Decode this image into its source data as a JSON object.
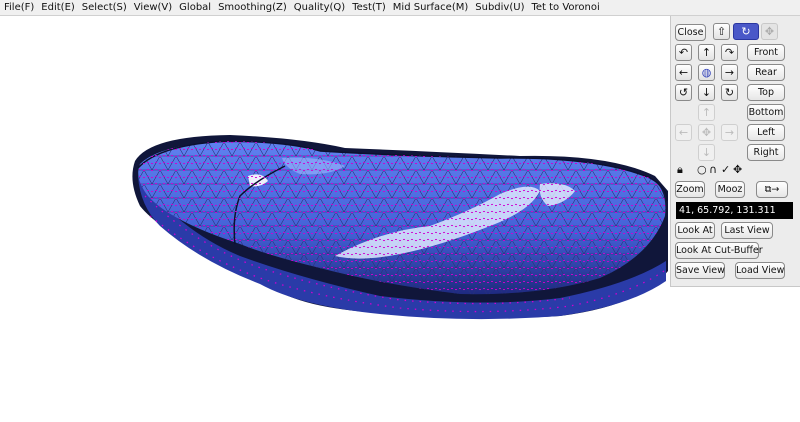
{
  "menu": [
    "File(F)",
    "Edit(E)",
    "Select(S)",
    "View(V)",
    "Global",
    "Smoothing(Z)",
    "Quality(Q)",
    "Test(T)",
    "Mid Surface(M)",
    "Subdiv(U)",
    "Tet to Voronoi"
  ],
  "panel": {
    "close": "Close",
    "views": {
      "front": "Front",
      "rear": "Rear",
      "top": "Top",
      "bottom": "Bottom",
      "left": "Left",
      "right": "Right"
    },
    "zoom": "Zoom",
    "mooz": "Mooz",
    "coords": "41, 65.792, 131.311",
    "look_at": "Look At",
    "last_view": "Last View",
    "look_at_cut_buffer": "Look At Cut-Buffer",
    "save_view": "Save View",
    "load_view": "Load View"
  },
  "icons": {
    "mode": [
      "up-arrow-icon",
      "rotate-icon",
      "move-icon"
    ],
    "rotation": [
      "rotate-ccw-icon",
      "arrow-up-icon",
      "rotate-cw-icon",
      "arrow-left-icon",
      "globe-icon",
      "arrow-right-icon",
      "roll-left-icon",
      "arrow-down-icon",
      "roll-right-icon"
    ],
    "pan": [
      "pan-up-icon",
      "pan-left-icon",
      "pan-center-icon",
      "pan-right-icon",
      "pan-down-icon"
    ],
    "toolbar": [
      "lock-icon",
      "circle-icon",
      "loop-icon",
      "check-icon",
      "move-cross-icon",
      "copy-view-icon"
    ]
  },
  "colors": {
    "mesh": "#4d6ee0",
    "vertex": "#d000d0",
    "edge": "#202060",
    "background": "#ffffff"
  }
}
